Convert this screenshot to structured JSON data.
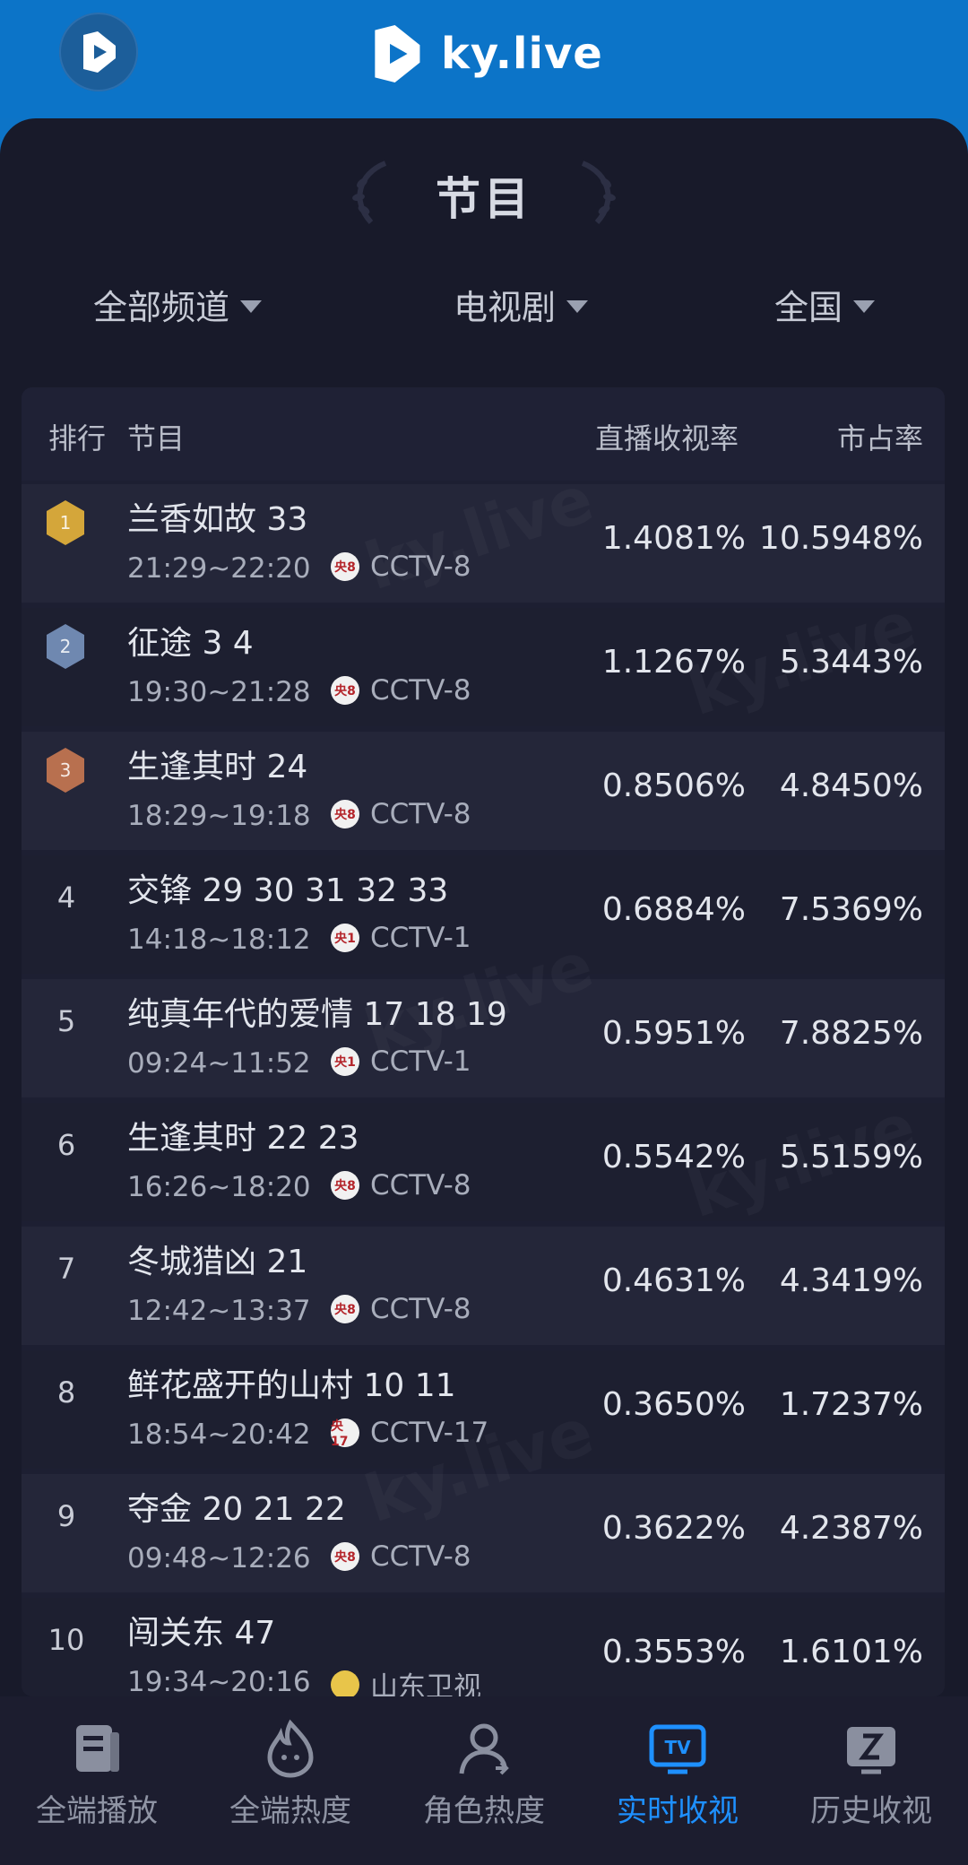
{
  "header": {
    "brand": "ky.live"
  },
  "page": {
    "title": "节目",
    "filters": [
      {
        "label": "全部频道"
      },
      {
        "label": "电视剧"
      },
      {
        "label": "全国"
      }
    ]
  },
  "table": {
    "headers": {
      "rank": "排行",
      "program": "节目",
      "rating": "直播收视率",
      "share": "市占率"
    },
    "rows": [
      {
        "rank": "1",
        "program": "兰香如故 33",
        "time": "21:29~22:20",
        "channel": "CCTV-8",
        "channel_logo": "央8",
        "rating": "1.4081%",
        "share": "10.5948%"
      },
      {
        "rank": "2",
        "program": "征途 3 4",
        "time": "19:30~21:28",
        "channel": "CCTV-8",
        "channel_logo": "央8",
        "rating": "1.1267%",
        "share": "5.3443%"
      },
      {
        "rank": "3",
        "program": "生逢其时 24",
        "time": "18:29~19:18",
        "channel": "CCTV-8",
        "channel_logo": "央8",
        "rating": "0.8506%",
        "share": "4.8450%"
      },
      {
        "rank": "4",
        "program": "交锋 29 30 31 32 33",
        "time": "14:18~18:12",
        "channel": "CCTV-1",
        "channel_logo": "央1",
        "rating": "0.6884%",
        "share": "7.5369%"
      },
      {
        "rank": "5",
        "program": "纯真年代的爱情 17 18 19",
        "time": "09:24~11:52",
        "channel": "CCTV-1",
        "channel_logo": "央1",
        "rating": "0.5951%",
        "share": "7.8825%"
      },
      {
        "rank": "6",
        "program": "生逢其时 22 23",
        "time": "16:26~18:20",
        "channel": "CCTV-8",
        "channel_logo": "央8",
        "rating": "0.5542%",
        "share": "5.5159%"
      },
      {
        "rank": "7",
        "program": "冬城猎凶 21",
        "time": "12:42~13:37",
        "channel": "CCTV-8",
        "channel_logo": "央8",
        "rating": "0.4631%",
        "share": "4.3419%"
      },
      {
        "rank": "8",
        "program": "鲜花盛开的山村 10 11",
        "time": "18:54~20:42",
        "channel": "CCTV-17",
        "channel_logo": "央17",
        "rating": "0.3650%",
        "share": "1.7237%"
      },
      {
        "rank": "9",
        "program": "夺金 20 21 22",
        "time": "09:48~12:26",
        "channel": "CCTV-8",
        "channel_logo": "央8",
        "rating": "0.3622%",
        "share": "4.2387%"
      },
      {
        "rank": "10",
        "program": "闯关东 47",
        "time": "19:34~20:16",
        "channel": "山东卫视",
        "channel_logo": "",
        "rating": "0.3553%",
        "share": "1.6101%"
      }
    ]
  },
  "nav": {
    "items": [
      {
        "label": "全端播放",
        "icon": "book-icon"
      },
      {
        "label": "全端热度",
        "icon": "flame-icon"
      },
      {
        "label": "角色热度",
        "icon": "person-icon"
      },
      {
        "label": "实时收视",
        "icon": "tv-icon"
      },
      {
        "label": "历史收视",
        "icon": "history-icon"
      }
    ],
    "active_index": 3,
    "active_color": "#1e90ff"
  }
}
